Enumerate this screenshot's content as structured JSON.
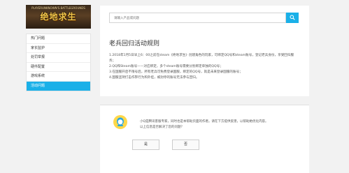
{
  "logo": {
    "title": "绝地求生",
    "subtitle": "PLAYERUNKNOWN'S BATTLEGROUNDS"
  },
  "sidebar": {
    "items": [
      {
        "label": "热门问题",
        "active": false
      },
      {
        "label": "家长监护",
        "active": false
      },
      {
        "label": "处罚举报",
        "active": false
      },
      {
        "label": "硬件配置",
        "active": false
      },
      {
        "label": "游戏系统",
        "active": false
      },
      {
        "label": "活动问题",
        "active": true
      }
    ]
  },
  "search": {
    "placeholder": "请输入产品或问题",
    "icon": "search-icon"
  },
  "article": {
    "title": "老兵回归活动规则",
    "lines": [
      "1.2018年1月5日早上6：00之前在steam《绝地求生》创建角色的玩家，可绑定QQ号和steam账号，登记老兵身份，享受回归服务；",
      "2.QQ和Steam账号——对应绑定，多个steam账号需要分别绑定单独的QQ号；",
      "3.在国服开启不限号后，所有老兵可免费登录国服，绑定的QQ号，就是未来登录国服的账号；",
      "4.国服坚持打击作弊行为和外挂，被封停的账号无法参与回归。"
    ]
  },
  "feedback": {
    "line1": "小Q是腾讯客服专家，同时也是本帮助页面的作者。请在下方提供反馈，以帮助她优化内容。",
    "line2": "以上信息是否解决了您的问题？",
    "yes_label": "是",
    "no_label": "否"
  },
  "colors": {
    "accent": "#1ab0e8",
    "background": "#f2f2f2"
  }
}
